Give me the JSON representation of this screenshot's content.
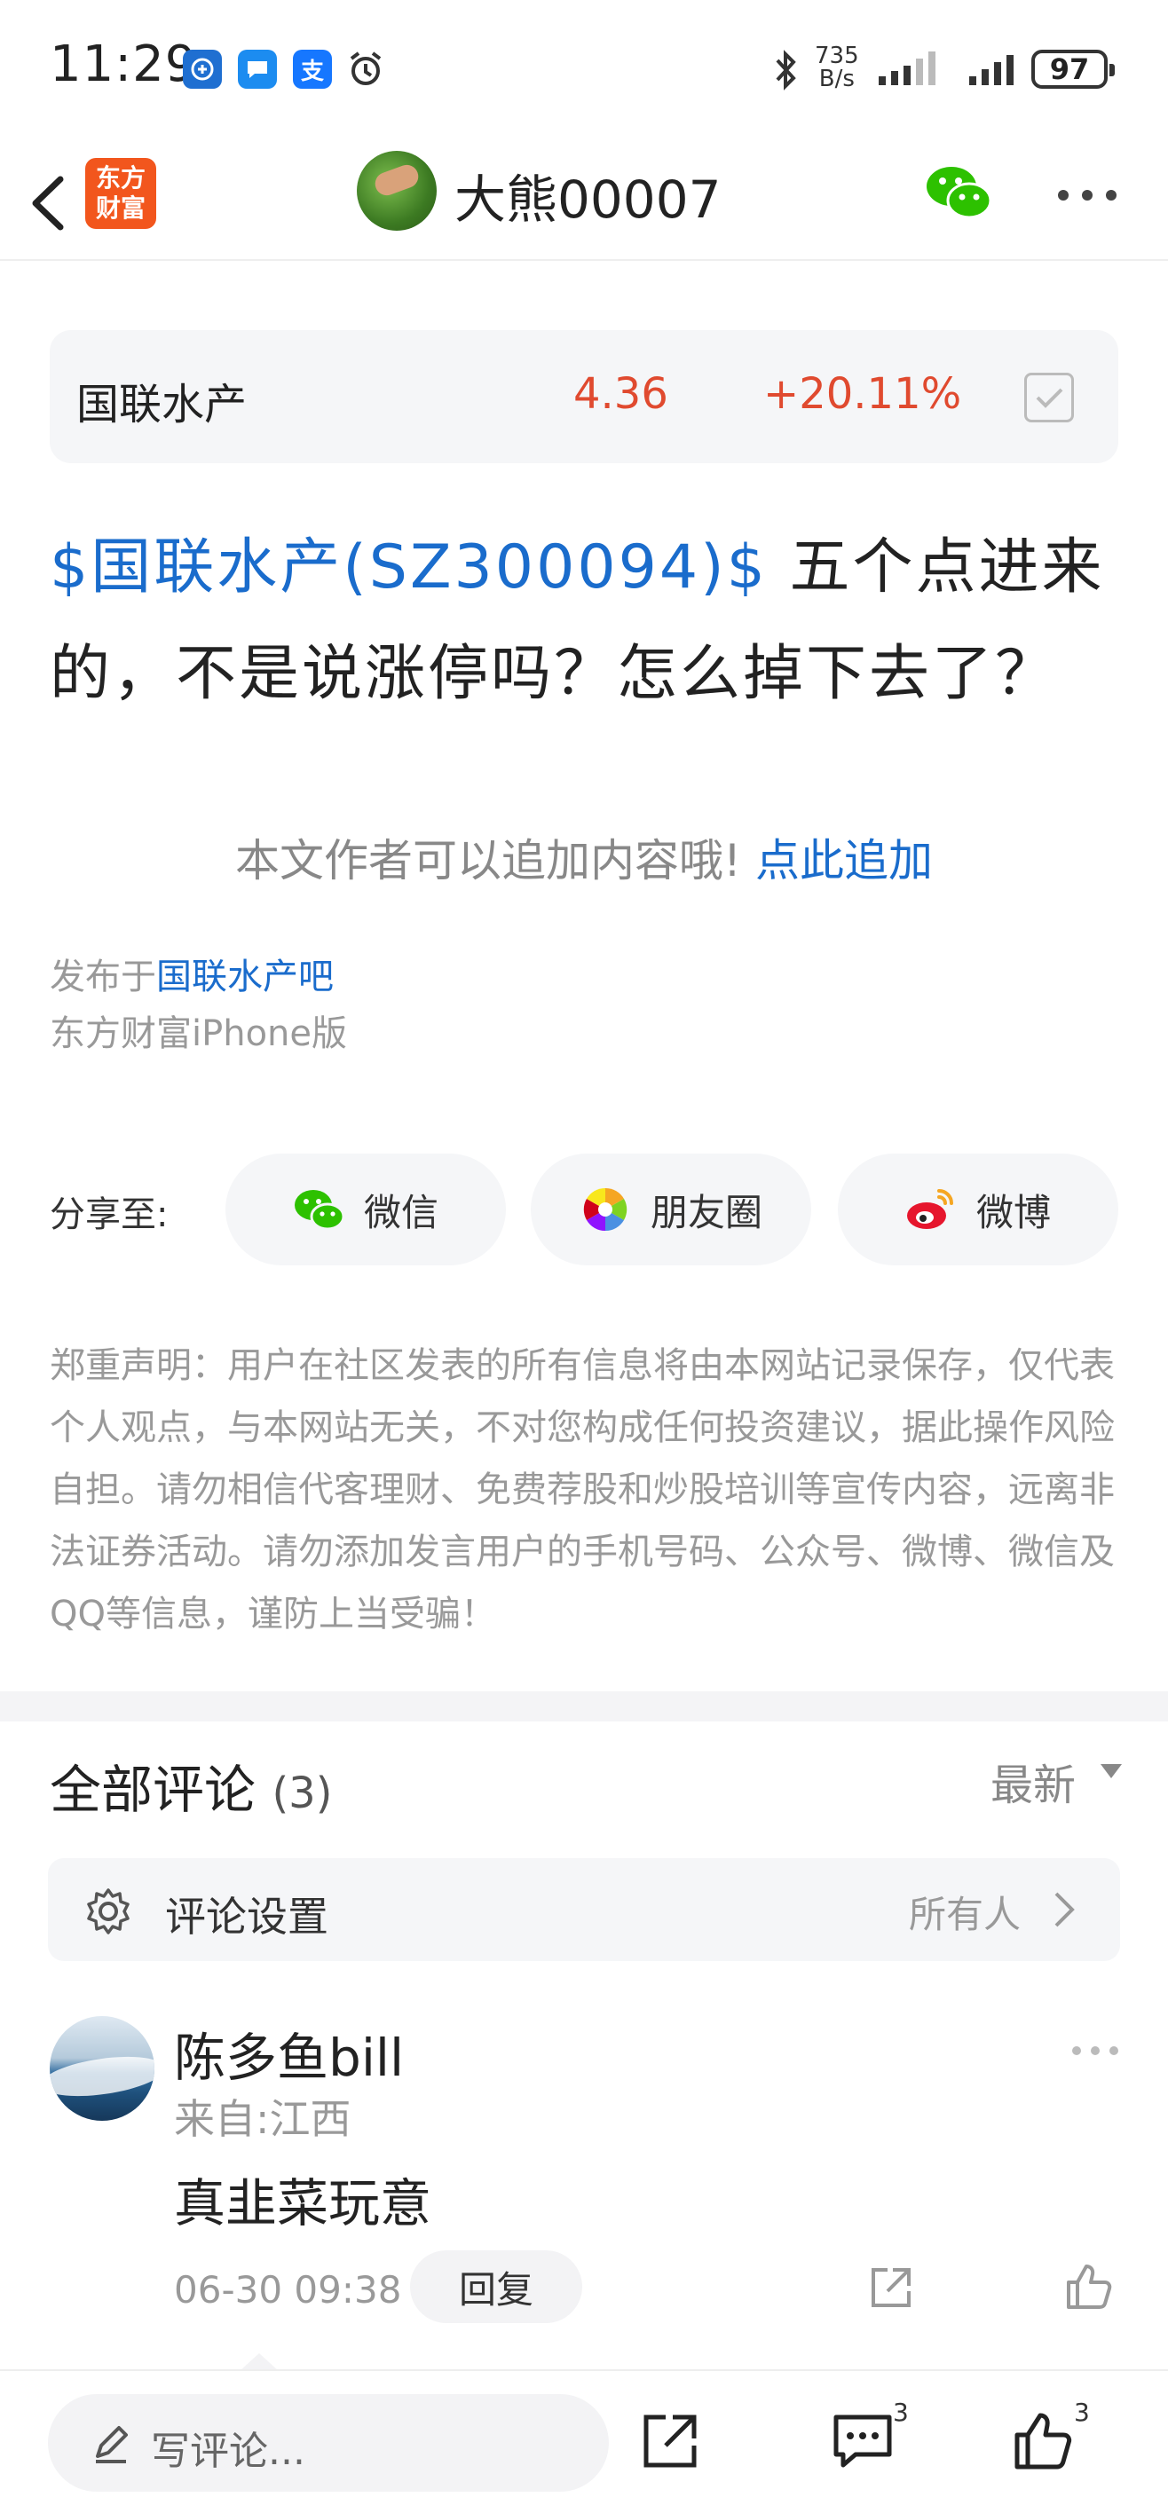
{
  "status_bar": {
    "time": "11:29",
    "network_speed_top": "735",
    "network_speed_bottom": "B/s",
    "battery": "97",
    "app_icons": [
      "qq-browser-icon",
      "message-icon",
      "alipay-icon",
      "alarm-icon"
    ],
    "alipay_glyph": "支"
  },
  "nav": {
    "app_logo_line1": "东方",
    "app_logo_line2": "财富",
    "title": "大熊00007"
  },
  "stock_card": {
    "name": "国联水产",
    "price": "4.36",
    "change": "+20.11%",
    "color_up": "#e04a2f"
  },
  "post": {
    "stock_link": "$国联水产(SZ300094)$",
    "text": " 五个点进来的，不是说涨停吗？怎么掉下去了？",
    "append_prompt": "本文作者可以追加内容哦!",
    "append_link": "点此追加",
    "published_prefix": "发布于",
    "published_bar": "国联水产吧",
    "client": "东方财富iPhone版"
  },
  "share": {
    "label": "分享至:",
    "wechat": "微信",
    "moments": "朋友圈",
    "weibo": "微博"
  },
  "disclaimer": "郑重声明：用户在社区发表的所有信息将由本网站记录保存，仅代表个人观点，与本网站无关，不对您构成任何投资建议，据此操作风险自担。请勿相信代客理财、免费荐股和炒股培训等宣传内容，远离非法证券活动。请勿添加发言用户的手机号码、公众号、微博、微信及QQ等信息，谨防上当受骗！",
  "comments": {
    "title": "全部评论",
    "count": "(3)",
    "sort": "最新",
    "settings_label": "评论设置",
    "settings_value": "所有人",
    "items": [
      {
        "name": "陈多鱼bill",
        "from": "来自:江西",
        "text": "真韭菜玩意",
        "time": "06-30 09:38",
        "reply_label": "回复"
      }
    ]
  },
  "bottom_bar": {
    "placeholder": "写评论...",
    "comment_count": "3",
    "like_count": "3"
  },
  "colors": {
    "link": "#1a6ccc",
    "brand": "#f2561d",
    "wechat_green": "#2dc100"
  }
}
